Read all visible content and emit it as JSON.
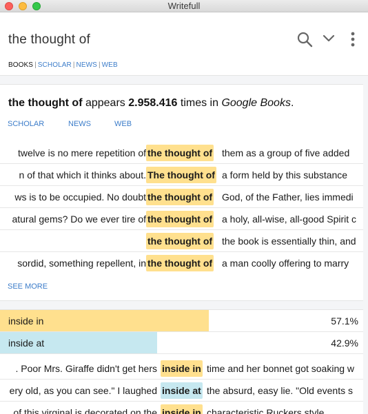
{
  "window": {
    "title": "Writefull"
  },
  "search": {
    "query": "the thought of"
  },
  "sources": {
    "active": "BOOKS",
    "links": [
      "SCHOLAR",
      "NEWS",
      "WEB"
    ]
  },
  "summary": {
    "phrase": "the thought of",
    "appears": " appears ",
    "count": "2.958.416",
    "times_in": " times in ",
    "source": "Google Books",
    "period": "."
  },
  "sublinks": [
    "SCHOLAR",
    "NEWS",
    "WEB"
  ],
  "examples": [
    {
      "left": "twelve is no mere repetition of",
      "match": "the thought of",
      "right": "them as a group of five added"
    },
    {
      "left": "n of that which it thinks about.",
      "match": "The thought of",
      "right": "a form held by this substance"
    },
    {
      "left": "ws is to be occupied. No doubt",
      "match": "the thought of",
      "right": "God, of the Father, lies immedi"
    },
    {
      "left": "atural gems? Do we ever tire of",
      "match": "the thought of",
      "right": "a holy, all-wise, all-good Spirit c"
    },
    {
      "left": "",
      "match": "the thought of",
      "right": "the book is essentially thin, and"
    },
    {
      "left": "sordid, something repellent, in",
      "match": "the thought of",
      "right": "a man coolly offering to marry"
    }
  ],
  "see_more": "SEE MORE",
  "variants": [
    {
      "label": "inside in",
      "percent": "57.1%",
      "share": 0.571,
      "color": "#ffe08e"
    },
    {
      "label": "inside at",
      "percent": "42.9%",
      "share": 0.429,
      "color": "#c6e8f0"
    }
  ],
  "variant_examples": [
    {
      "left": ". Poor Mrs. Giraffe didn't get hers",
      "match": "inside in",
      "right": "time and her bonnet got soaking w",
      "tone": "yellow"
    },
    {
      "left": "ery old, as you can see.\" I laughed",
      "match": "inside at",
      "right": "the absurd, easy lie. \"Old events s",
      "tone": "blue"
    },
    {
      "left": "of this virginal is decorated on the",
      "match": "inside in",
      "right": "characteristic Ruckers style",
      "tone": "yellow"
    }
  ]
}
